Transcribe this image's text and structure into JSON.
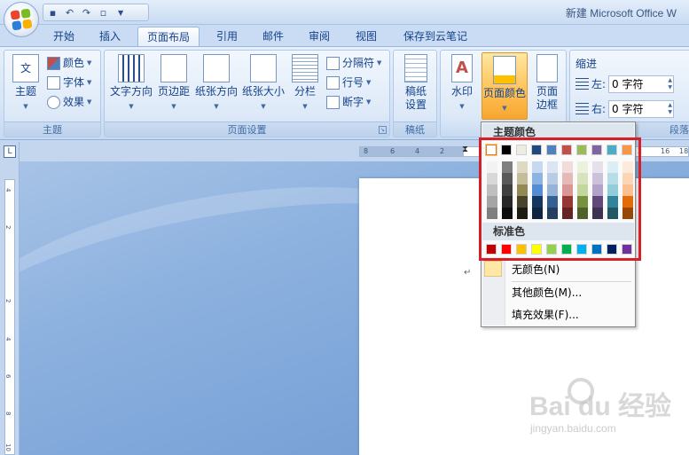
{
  "window": {
    "title": "新建 Microsoft Office W"
  },
  "qat": {
    "icons": [
      "save-icon",
      "undo-icon",
      "redo-icon",
      "print-preview-icon"
    ],
    "undo_glyph": "↶",
    "redo_glyph": "↷",
    "save_glyph": "▪",
    "preview_glyph": "▫"
  },
  "tabs": [
    "开始",
    "插入",
    "页面布局",
    "引用",
    "邮件",
    "审阅",
    "视图",
    "保存到云笔记"
  ],
  "active_tab": "页面布局",
  "ribbon": {
    "theme_group": {
      "label": "主题",
      "theme_btn": "主题",
      "theme_icon_text": "文",
      "colors": "颜色",
      "fonts": "字体",
      "effects": "效果"
    },
    "page_setup_group": {
      "label": "页面设置",
      "text_direction": "文字方向",
      "margins": "页边距",
      "orientation": "纸张方向",
      "size": "纸张大小",
      "columns": "分栏",
      "breaks": "分隔符",
      "line_numbers": "行号",
      "hyphenation": "断字"
    },
    "draft_group": {
      "label": "稿纸",
      "draft_line1": "稿纸",
      "draft_line2": "设置"
    },
    "page_bg_group": {
      "watermark": "水印",
      "page_color": "页面颜色",
      "borders_line1": "页面",
      "borders_line2": "边框"
    },
    "indent_group": {
      "label": "缩进",
      "left_label": "左:",
      "left_value": "0 字符",
      "right_label": "右:",
      "right_value": "0 字符"
    },
    "paragraph_partial": "段落"
  },
  "hruler": {
    "numbers": [
      "8",
      "6",
      "4",
      "2",
      "2",
      "16",
      "18"
    ]
  },
  "vruler": {
    "numbers": [
      "4",
      "2",
      "2",
      "4",
      "6",
      "8",
      "10"
    ]
  },
  "dropdown": {
    "theme_colors_label": "主题颜色",
    "standard_colors_label": "标准色",
    "no_color": "无颜色(N)",
    "more_colors": "其他颜色(M)...",
    "fill_effects": "填充效果(F)...",
    "theme_colors": [
      "#ffffff",
      "#000000",
      "#eeece1",
      "#1f497d",
      "#4f81bd",
      "#c0504d",
      "#9bbb59",
      "#8064a2",
      "#4bacc6",
      "#f79646"
    ],
    "theme_shades": [
      [
        "#f2f2f2",
        "#d8d8d8",
        "#bfbfbf",
        "#a5a5a5",
        "#7f7f7f"
      ],
      [
        "#7f7f7f",
        "#595959",
        "#3f3f3f",
        "#262626",
        "#0c0c0c"
      ],
      [
        "#ddd9c3",
        "#c4bd97",
        "#938953",
        "#494429",
        "#1d1b10"
      ],
      [
        "#c6d9f0",
        "#8db3e2",
        "#548dd4",
        "#17365d",
        "#0f243e"
      ],
      [
        "#dbe5f1",
        "#b8cce4",
        "#95b3d7",
        "#366092",
        "#244061"
      ],
      [
        "#f2dcdb",
        "#e5b9b7",
        "#d99694",
        "#953734",
        "#632423"
      ],
      [
        "#ebf1dd",
        "#d7e3bc",
        "#c3d69b",
        "#76923c",
        "#4f6128"
      ],
      [
        "#e5e0ec",
        "#ccc1d9",
        "#b2a2c7",
        "#5f497a",
        "#3f3151"
      ],
      [
        "#dbeef3",
        "#b7dde8",
        "#92cddc",
        "#31859b",
        "#205867"
      ],
      [
        "#fdeada",
        "#fbd5b5",
        "#fac08f",
        "#e36c09",
        "#974806"
      ]
    ],
    "standard_colors": [
      "#c00000",
      "#ff0000",
      "#ffc000",
      "#ffff00",
      "#92d050",
      "#00b050",
      "#00b0f0",
      "#0070c0",
      "#002060",
      "#7030a0"
    ]
  },
  "watermark": {
    "brand": "Bai du 经验",
    "url": "jingyan.baidu.com"
  }
}
